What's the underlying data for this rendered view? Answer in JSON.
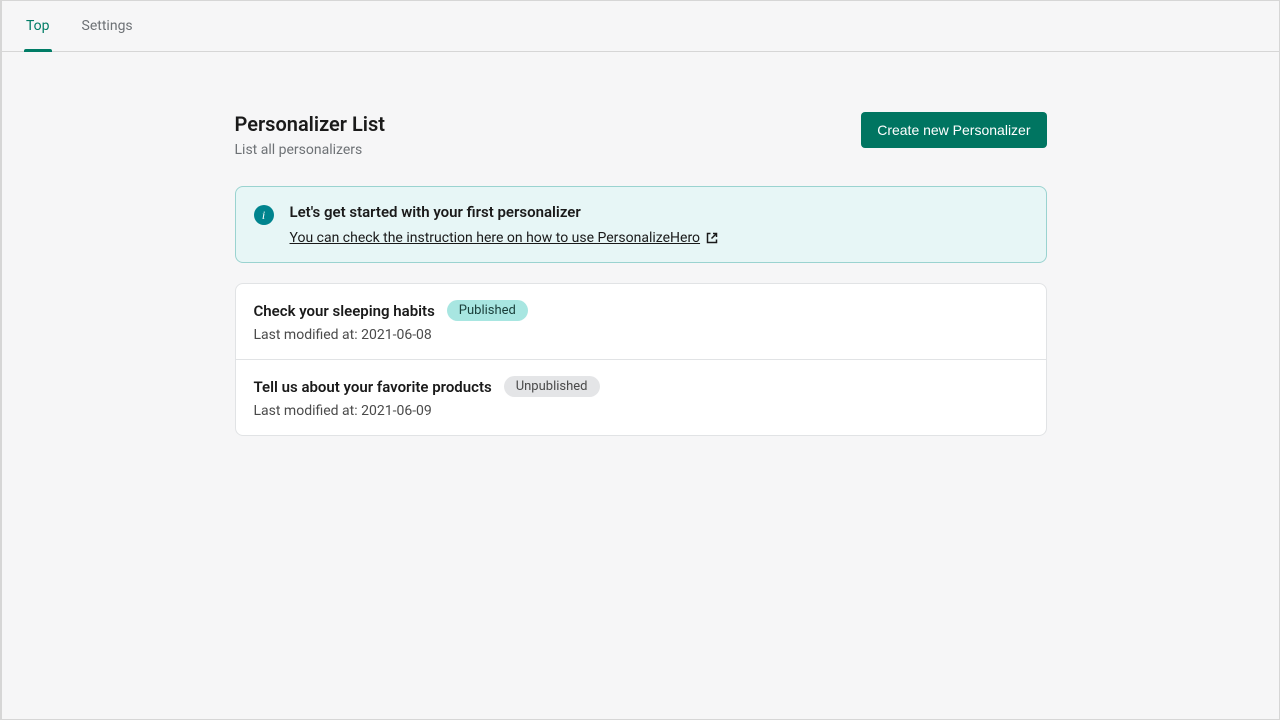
{
  "tabs": {
    "top": "Top",
    "settings": "Settings"
  },
  "header": {
    "title": "Personalizer List",
    "subtitle": "List all personalizers",
    "create_button": "Create new Personalizer"
  },
  "banner": {
    "title": "Let's get started with your first personalizer",
    "link_text": "You can check the instruction here on how to use PersonalizeHero"
  },
  "last_modified_label": "Last modified at: ",
  "status_labels": {
    "published": "Published",
    "unpublished": "Unpublished"
  },
  "items": [
    {
      "title": "Check your sleeping habits",
      "status": "published",
      "modified": "2021-06-08"
    },
    {
      "title": "Tell us about your favorite products",
      "status": "unpublished",
      "modified": "2021-06-09"
    }
  ]
}
